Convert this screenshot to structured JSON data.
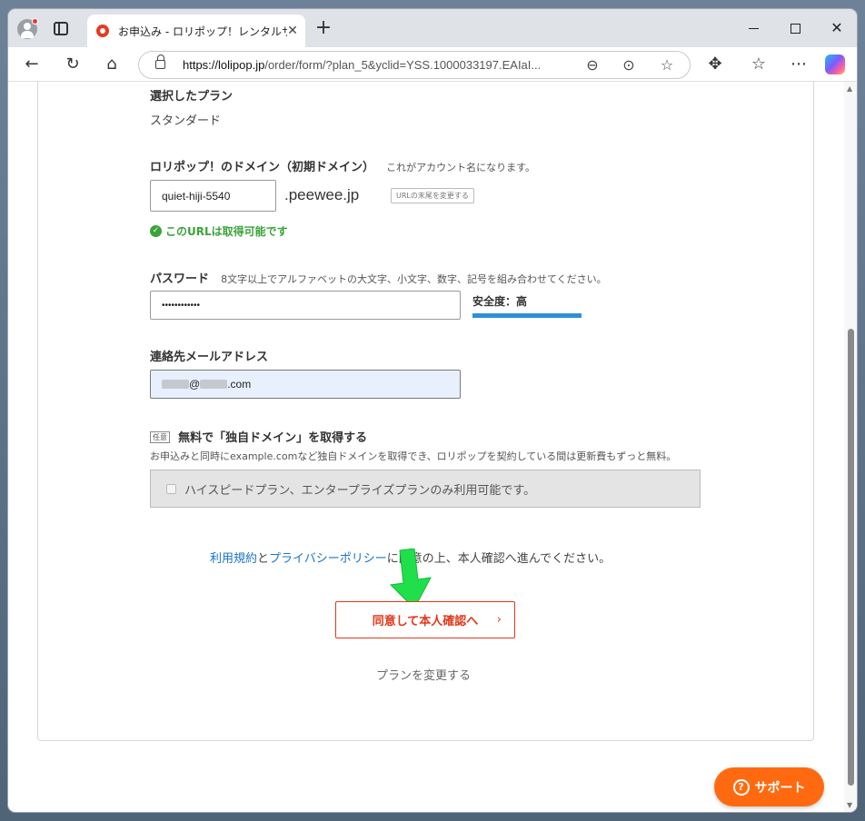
{
  "browser": {
    "tab_title": "お申込み - ロリポップ！レンタルサーバー",
    "tab_close": "✕",
    "new_tab": "+",
    "url_host": "https://lolipop.jp",
    "url_path": "/order/form/?plan_5&yclid=YSS.1000033197.EAIaI...",
    "icons": [
      "profile-icon",
      "tabs-icon",
      "back-icon",
      "reload-icon",
      "home-icon",
      "lock-icon",
      "zoom-icon",
      "more-icon",
      "favorite-icon",
      "extensions-icon",
      "favorites-icon",
      "menu-icon",
      "copilot-icon"
    ]
  },
  "form": {
    "plan": {
      "label": "選択したプラン",
      "value": "スタンダード"
    },
    "domain": {
      "label": "ロリポップ！のドメイン（初期ドメイン）",
      "hint": "これがアカウント名になります。",
      "value": "quiet-hiji-5540",
      "suffix": ".peewee.jp",
      "change_button": "URLの末尾を変更する",
      "status": "このURLは取得可能です"
    },
    "password": {
      "label": "パスワード",
      "hint": "8文字以上でアルファベットの大文字、小文字、数字、記号を組み合わせてください。",
      "value": "••••••••••••",
      "strength_label": "安全度：高",
      "strength_level": 1.0
    },
    "email": {
      "label": "連絡先メールアドレス",
      "at": "@",
      "tail": ".com"
    },
    "custom_domain": {
      "tag": "任意",
      "label": "無料で「独自ドメイン」を取得する",
      "description": "お申込みと同時にexample.comなど独自ドメインを取得でき、ロリポップを契約している間は更新費もずっと無料。",
      "disabled_text": "ハイスピードプラン、エンタープライズプランのみ利用可能です。"
    },
    "agreement": {
      "terms_link": "利用規約",
      "and": "と",
      "privacy_link": "プライバシーポリシー",
      "rest": "に同意の上、本人確認へ進んでください。"
    },
    "submit_label": "同意して本人確認へ",
    "submit_chevron": "›",
    "change_plan": "プランを変更する"
  },
  "support_label": "サポート",
  "support_icon": "?"
}
